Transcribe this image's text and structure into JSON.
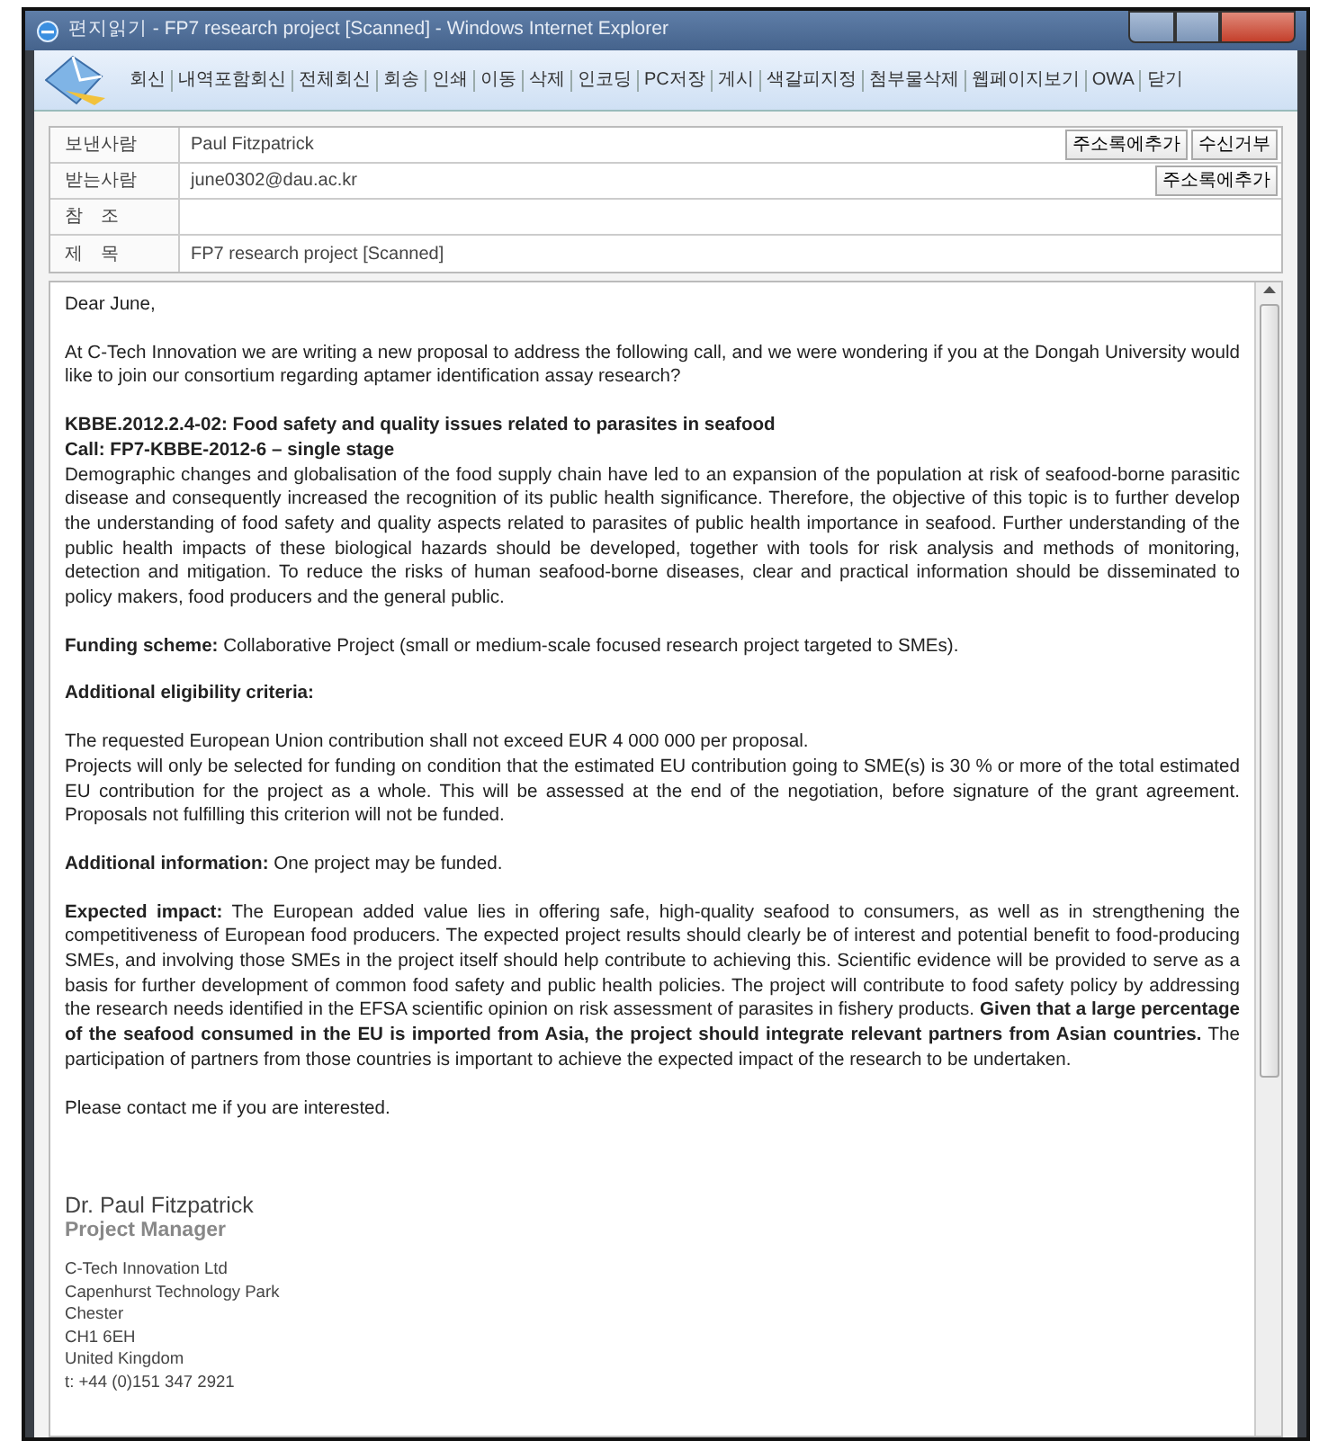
{
  "window": {
    "title": "편지읽기 - FP7 research project [Scanned] - Windows Internet Explorer"
  },
  "toolbar": {
    "items": [
      "회신",
      "내역포함회신",
      "전체회신",
      "회송",
      "인쇄",
      "이동",
      "삭제",
      "인코딩",
      "PC저장",
      "게시",
      "색갈피지정",
      "첨부물삭제",
      "웹페이지보기",
      "OWA",
      "닫기"
    ]
  },
  "header": {
    "rows": [
      {
        "label": "보낸사람",
        "value": "Paul Fitzpatrick",
        "buttons": [
          "주소록에추가",
          "수신거부"
        ]
      },
      {
        "label": "받는사람",
        "value": "june0302@dau.ac.kr",
        "buttons": [
          "주소록에추가"
        ]
      },
      {
        "label": "참　조"
      },
      {
        "label": "제　목",
        "value": "FP7 research project [Scanned]"
      }
    ]
  },
  "message": {
    "paragraphs": [
      [
        "Dear June,"
      ],
      [
        "At C-Tech Innovation we are writing a new proposal to address the following call, and we were wondering if you at the Dongah University would like to join our consortium regarding aptamer identification assay research?"
      ],
      [
        "**KBBE.2012.2.4-02: Food safety and quality issues related to parasites in seafood**",
        "**Call: FP7-KBBE-2012-6 – single stage**",
        "Demographic changes and globalisation of the food supply chain have led to an expansion of the population at risk of seafood-borne parasitic disease and consequently increased the recognition of its public health significance. Therefore, the objective of this topic is to further develop the understanding of food safety and quality aspects related to parasites of public health importance in seafood. Further understanding of the public health impacts of these biological hazards should be developed, together with tools for risk analysis and methods of monitoring, detection and mitigation. To reduce the risks of human seafood-borne diseases, clear and practical information should be disseminated to policy makers, food producers and the general public."
      ],
      [
        "**Funding scheme:** Collaborative Project (small or medium-scale focused research project targeted to SMEs)."
      ],
      [
        "**Additional eligibility criteria:**"
      ],
      [
        "The requested European Union contribution shall not exceed EUR 4 000 000 per proposal.",
        "Projects will only be selected for funding on condition that the estimated EU contribution going to SME(s) is 30 % or more of the total estimated EU contribution for the project as a whole. This will be assessed at the end of the negotiation, before signature of the grant agreement. Proposals not fulfilling this criterion will not be funded."
      ],
      [
        "**Additional information:** One project may be funded."
      ],
      [
        "**Expected impact:** The European added value lies in offering safe, high-quality seafood to consumers, as well as in strengthening the competitiveness of European food producers. The expected project results should clearly be of interest and potential benefit to food-producing SMEs, and involving those SMEs in the project itself should help contribute to achieving this. Scientific evidence will be provided to serve as a basis for further development of common food safety and public health policies. The project will contribute to food safety policy by addressing the research needs identified in the EFSA scientific opinion on risk assessment of parasites in fishery products. **Given that a large percentage of the seafood consumed in the EU is imported from Asia, the project should integrate relevant partners from Asian countries.** The participation of partners from those countries is important to achieve the expected impact of the research to be undertaken."
      ],
      [
        "Please contact me if you are interested."
      ]
    ],
    "signature": {
      "name": "Dr. Paul Fitzpatrick",
      "role": "Project Manager",
      "lines": [
        "C-Tech Innovation Ltd",
        "Capenhurst Technology Park",
        "Chester",
        "CH1 6EH",
        "United Kingdom",
        "t: +44 (0)151 347 2921"
      ]
    }
  }
}
